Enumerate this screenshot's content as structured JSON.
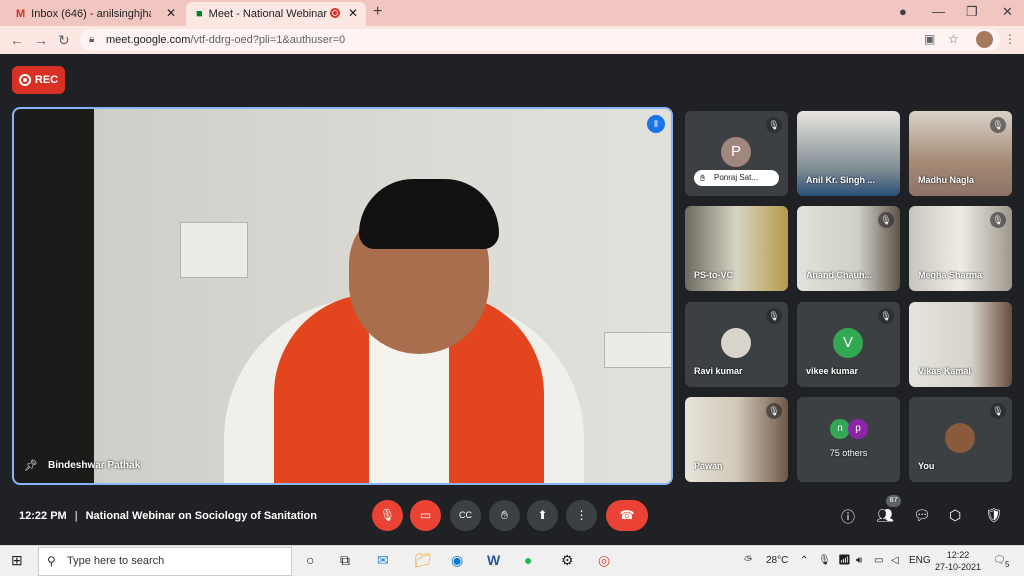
{
  "browser": {
    "tabs": [
      {
        "title": "Inbox (646) - anilsinghjha@cusb.",
        "icon": "gmail-icon"
      },
      {
        "title": "Meet - National Webinar on",
        "icon": "meet-icon"
      }
    ],
    "url_host": "meet.google.com",
    "url_path": "/vtf-ddrg-oed?pli=1&authuser=0"
  },
  "rec_label": "REC",
  "main_speaker": {
    "name": "Bindeshwar Pathak"
  },
  "participants": [
    {
      "name": "Ponraj Sat...",
      "initial": "P",
      "avatar_color": "#a1887f",
      "hand_raised": true
    },
    {
      "name": "Anil Kr. Singh ...",
      "video": true
    },
    {
      "name": "Madhu Nagla",
      "video": true,
      "muted": true
    },
    {
      "name": "PS-to-VC",
      "video": true
    },
    {
      "name": "Anand Chauh...",
      "video": true,
      "muted": true
    },
    {
      "name": "Megha Sharma",
      "video": true,
      "muted": true
    },
    {
      "name": "Ravi kumar",
      "muted": true
    },
    {
      "name": "vikee kumar",
      "initial": "V",
      "avatar_color": "#33a852",
      "muted": true
    },
    {
      "name": "Vikas Kamal",
      "video": true
    },
    {
      "name": "Pawan",
      "video": true,
      "muted": true
    },
    {
      "name": "75 others",
      "initials": [
        "n",
        "p"
      ]
    },
    {
      "name": "You",
      "muted": true
    }
  ],
  "meeting": {
    "time": "12:22 PM",
    "title": "National Webinar on Sociology of Sanitation",
    "people_count": "87"
  },
  "taskbar": {
    "search_placeholder": "Type here to search",
    "temperature": "28°C",
    "language": "ENG",
    "clock_time": "12:22",
    "clock_date": "27-10-2021",
    "notification_count": "5"
  },
  "colors": {
    "meet_bg": "#202124",
    "end_call": "#ea4335",
    "active_border": "#8ab4f8",
    "tab_strip": "#f1c5c0"
  }
}
